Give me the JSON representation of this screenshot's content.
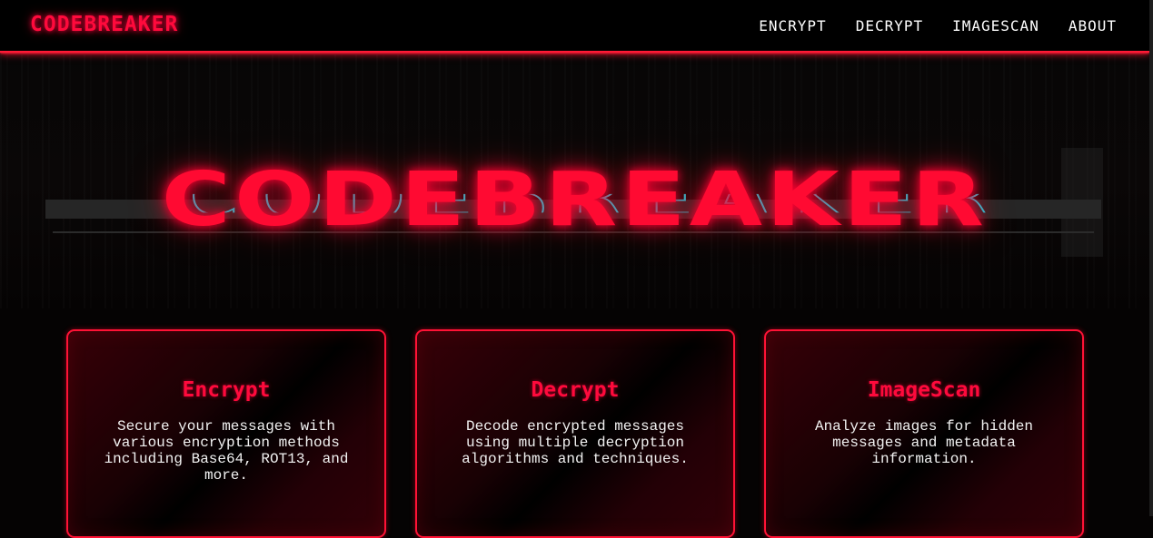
{
  "navbar": {
    "brand": "CODEBREAKER",
    "links": [
      {
        "label": "ENCRYPT"
      },
      {
        "label": "DECRYPT"
      },
      {
        "label": "IMAGESCAN"
      },
      {
        "label": "ABOUT"
      }
    ]
  },
  "hero": {
    "title": "CODEBREAKER"
  },
  "cards": [
    {
      "title": "Encrypt",
      "description": "Secure your messages with various encryption methods including Base64, ROT13, and more."
    },
    {
      "title": "Decrypt",
      "description": "Decode encrypted messages using multiple decryption algorithms and techniques."
    },
    {
      "title": "ImageScan",
      "description": "Analyze images for hidden messages and metadata information."
    }
  ],
  "colors": {
    "accent": "#ff0a3c",
    "glitch": "#11d4e6",
    "background": "#050303"
  }
}
